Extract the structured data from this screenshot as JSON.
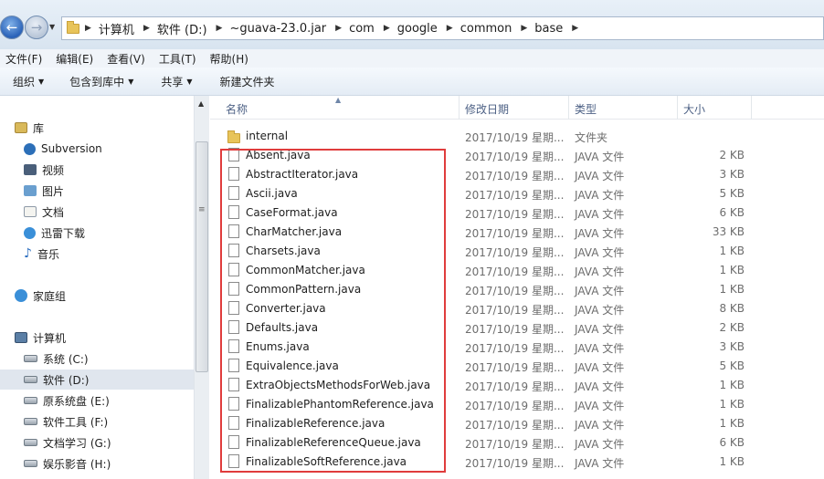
{
  "address_bar": {
    "crumbs": [
      "计算机",
      "软件 (D:)",
      "~guava-23.0.jar",
      "com",
      "google",
      "common",
      "base"
    ]
  },
  "menu": [
    "文件(F)",
    "编辑(E)",
    "查看(V)",
    "工具(T)",
    "帮助(H)"
  ],
  "toolbar": {
    "organize": "组织",
    "include_in_library": "包含到库中",
    "share": "共享",
    "new_folder": "新建文件夹"
  },
  "nav": {
    "libraries": "库",
    "subversion": "Subversion",
    "videos": "视频",
    "pictures": "图片",
    "documents": "文档",
    "xunlei": "迅雷下载",
    "music": "音乐",
    "homegroup": "家庭组",
    "computer": "计算机",
    "drive_c": "系统 (C:)",
    "drive_d": "软件 (D:)",
    "drive_e": "原系统盘 (E:)",
    "drive_f": "软件工具 (F:)",
    "drive_g": "文档学习 (G:)",
    "drive_h": "娱乐影音 (H:)"
  },
  "columns": {
    "name": "名称",
    "date": "修改日期",
    "type": "类型",
    "size": "大小"
  },
  "files": [
    {
      "name": "internal",
      "date": "2017/10/19 星期...",
      "type": "文件夹",
      "size": "",
      "kind": "folder"
    },
    {
      "name": "Absent.java",
      "date": "2017/10/19 星期...",
      "type": "JAVA 文件",
      "size": "2 KB",
      "kind": "file"
    },
    {
      "name": "AbstractIterator.java",
      "date": "2017/10/19 星期...",
      "type": "JAVA 文件",
      "size": "3 KB",
      "kind": "file"
    },
    {
      "name": "Ascii.java",
      "date": "2017/10/19 星期...",
      "type": "JAVA 文件",
      "size": "5 KB",
      "kind": "file"
    },
    {
      "name": "CaseFormat.java",
      "date": "2017/10/19 星期...",
      "type": "JAVA 文件",
      "size": "6 KB",
      "kind": "file"
    },
    {
      "name": "CharMatcher.java",
      "date": "2017/10/19 星期...",
      "type": "JAVA 文件",
      "size": "33 KB",
      "kind": "file"
    },
    {
      "name": "Charsets.java",
      "date": "2017/10/19 星期...",
      "type": "JAVA 文件",
      "size": "1 KB",
      "kind": "file"
    },
    {
      "name": "CommonMatcher.java",
      "date": "2017/10/19 星期...",
      "type": "JAVA 文件",
      "size": "1 KB",
      "kind": "file"
    },
    {
      "name": "CommonPattern.java",
      "date": "2017/10/19 星期...",
      "type": "JAVA 文件",
      "size": "1 KB",
      "kind": "file"
    },
    {
      "name": "Converter.java",
      "date": "2017/10/19 星期...",
      "type": "JAVA 文件",
      "size": "8 KB",
      "kind": "file"
    },
    {
      "name": "Defaults.java",
      "date": "2017/10/19 星期...",
      "type": "JAVA 文件",
      "size": "2 KB",
      "kind": "file"
    },
    {
      "name": "Enums.java",
      "date": "2017/10/19 星期...",
      "type": "JAVA 文件",
      "size": "3 KB",
      "kind": "file"
    },
    {
      "name": "Equivalence.java",
      "date": "2017/10/19 星期...",
      "type": "JAVA 文件",
      "size": "5 KB",
      "kind": "file"
    },
    {
      "name": "ExtraObjectsMethodsForWeb.java",
      "date": "2017/10/19 星期...",
      "type": "JAVA 文件",
      "size": "1 KB",
      "kind": "file"
    },
    {
      "name": "FinalizablePhantomReference.java",
      "date": "2017/10/19 星期...",
      "type": "JAVA 文件",
      "size": "1 KB",
      "kind": "file"
    },
    {
      "name": "FinalizableReference.java",
      "date": "2017/10/19 星期...",
      "type": "JAVA 文件",
      "size": "1 KB",
      "kind": "file"
    },
    {
      "name": "FinalizableReferenceQueue.java",
      "date": "2017/10/19 星期...",
      "type": "JAVA 文件",
      "size": "6 KB",
      "kind": "file"
    },
    {
      "name": "FinalizableSoftReference.java",
      "date": "2017/10/19 星期...",
      "type": "JAVA 文件",
      "size": "1 KB",
      "kind": "file"
    }
  ],
  "colors": {
    "highlight": "#e03c3c",
    "header_text": "#4d6185",
    "folder": "#e8c45a"
  }
}
